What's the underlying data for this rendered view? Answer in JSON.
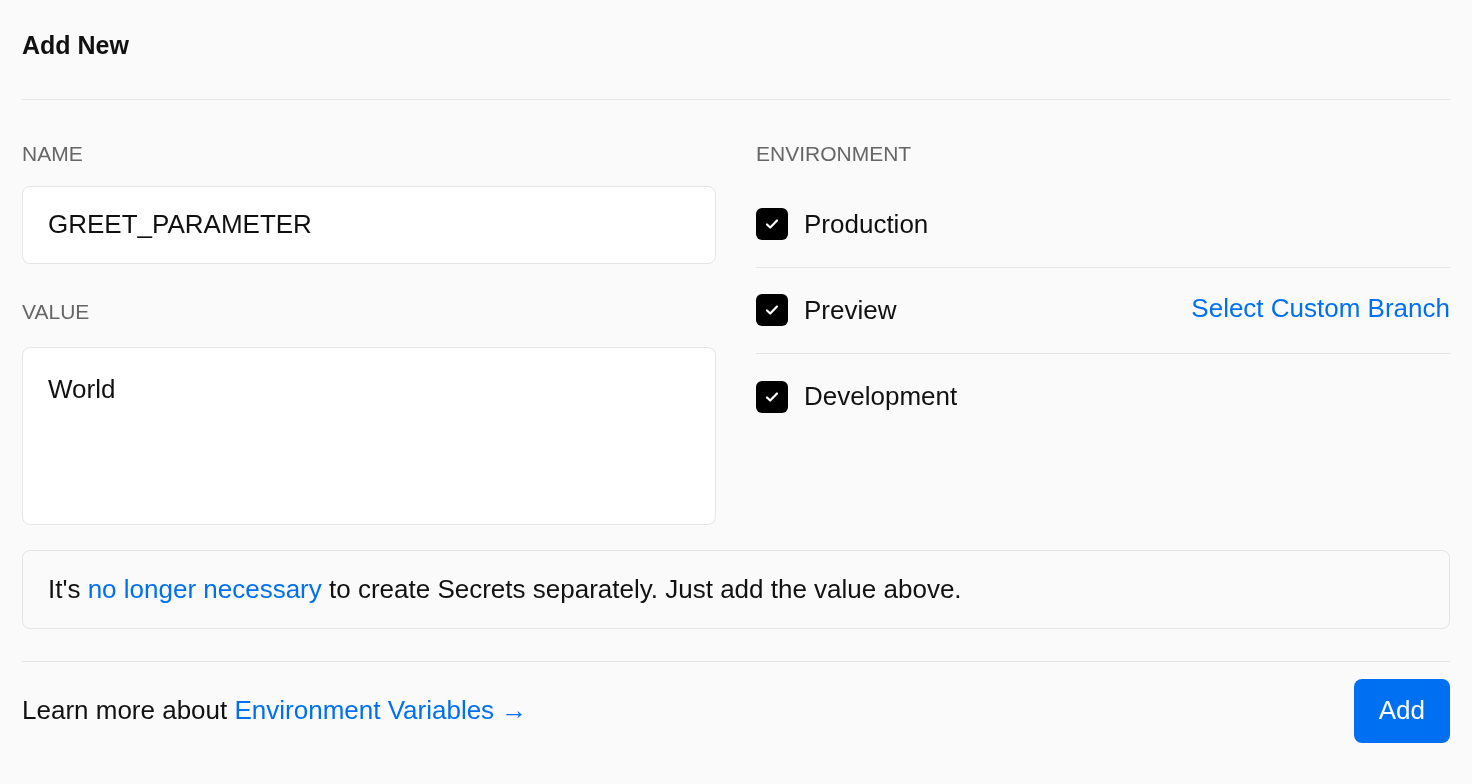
{
  "title": "Add New",
  "name_field": {
    "label": "NAME",
    "value": "GREET_PARAMETER"
  },
  "value_field": {
    "label": "VALUE",
    "value": "World"
  },
  "environment": {
    "label": "ENVIRONMENT",
    "options": [
      {
        "label": "Production",
        "checked": true
      },
      {
        "label": "Preview",
        "checked": true,
        "link": "Select Custom Branch"
      },
      {
        "label": "Development",
        "checked": true
      }
    ]
  },
  "notice": {
    "before": "It's ",
    "link": "no longer necessary",
    "after": " to create Secrets separately. Just add the value above."
  },
  "footer": {
    "text": "Learn more about ",
    "link": "Environment Variables →"
  },
  "buttons": [
    "Add"
  ]
}
